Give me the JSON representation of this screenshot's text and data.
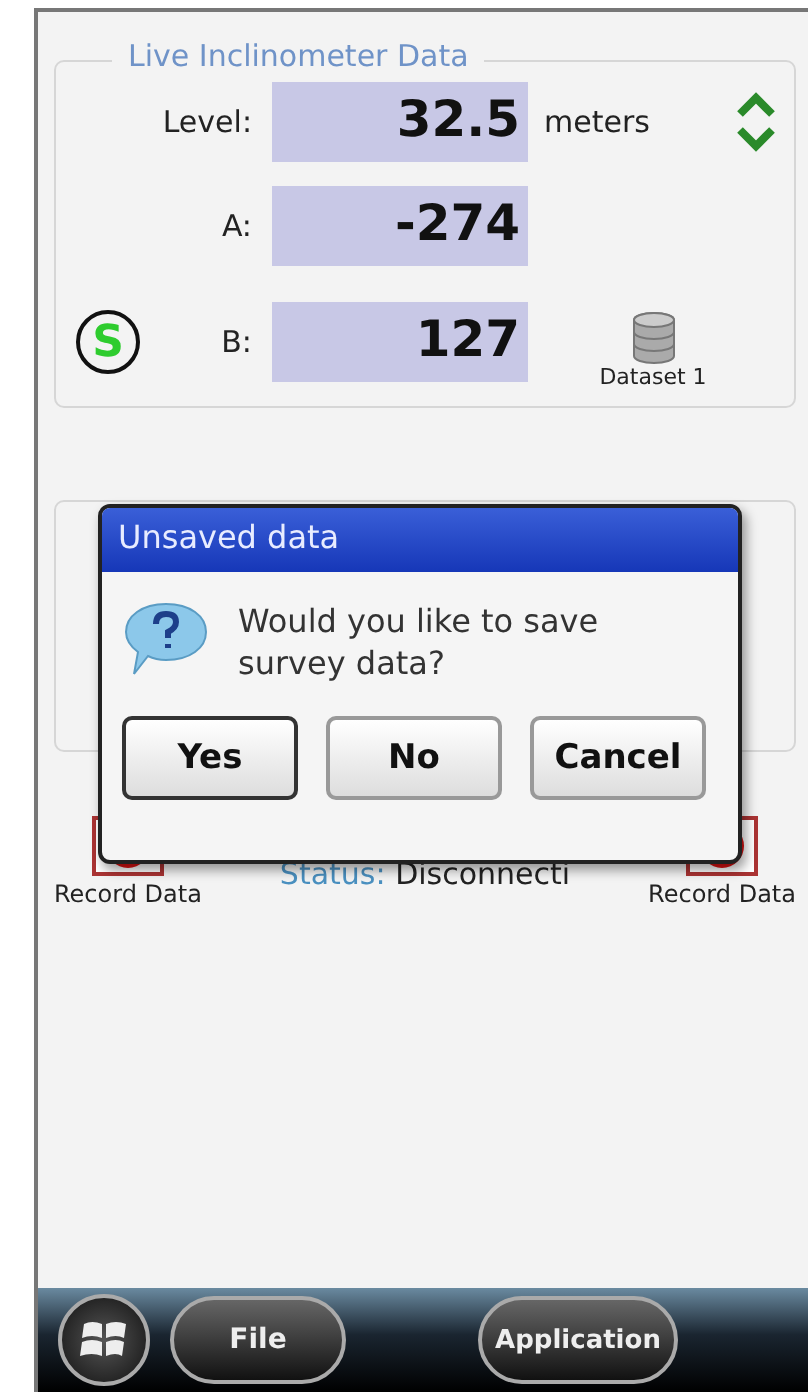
{
  "panel": {
    "title": "Live Inclinometer Data",
    "rows": [
      {
        "label": "Level:",
        "value": "32.5",
        "unit": "meters"
      },
      {
        "label": "A:",
        "value": "-274"
      },
      {
        "label": "B:",
        "value": "127"
      }
    ],
    "status_badge": "S",
    "dataset": "Dataset 1"
  },
  "record_buttons": [
    "Record Data",
    "Record Data"
  ],
  "status": {
    "label": "Status:",
    "value": "Disconnecti"
  },
  "dialog": {
    "title": "Unsaved data",
    "message": "Would you like to save survey data?",
    "buttons": [
      {
        "label": "Yes",
        "selected": true
      },
      {
        "label": "No",
        "selected": false
      },
      {
        "label": "Cancel",
        "selected": false
      }
    ]
  },
  "menu_bar": {
    "left": "File",
    "right": "Application"
  }
}
